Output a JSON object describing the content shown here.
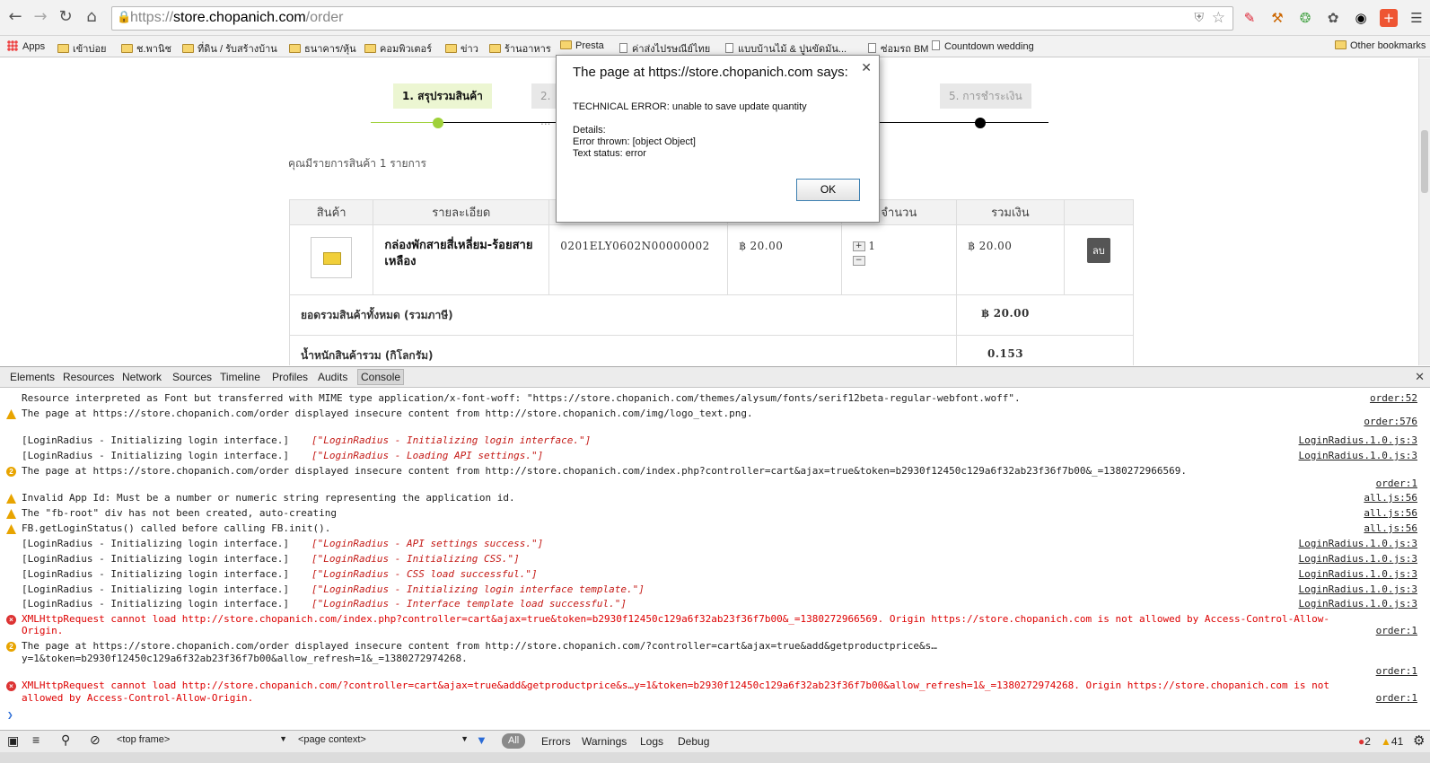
{
  "browser": {
    "url_proto": "https://",
    "url_host": "store.chopanich.com",
    "url_path": "/order",
    "bookmarks": [
      {
        "label": "Apps",
        "kind": "apps"
      },
      {
        "label": "เข้าบ่อย",
        "kind": "folder"
      },
      {
        "label": "ช.พานิช",
        "kind": "folder"
      },
      {
        "label": "ที่ดิน / รับสร้างบ้าน",
        "kind": "folder"
      },
      {
        "label": "ธนาคาร/หุ้น",
        "kind": "folder"
      },
      {
        "label": "คอมพิวเตอร์",
        "kind": "folder"
      },
      {
        "label": "ข่าว",
        "kind": "folder"
      },
      {
        "label": "ร้านอาหาร",
        "kind": "folder"
      },
      {
        "label": "Presta",
        "kind": "folder"
      },
      {
        "label": "ค่าส่งไปรษณีย์ไทย",
        "kind": "page"
      },
      {
        "label": "แบบบ้านไม้ & ปูนขัดมัน...",
        "kind": "page"
      },
      {
        "label": "ซ่อมรถ BM",
        "kind": "page"
      },
      {
        "label": "Countdown wedding",
        "kind": "page"
      }
    ],
    "other_bookmarks": "Other bookmarks"
  },
  "page": {
    "step1": "1. สรุปรวมสินค้า",
    "step2": "2. ...",
    "step5": "5. การชำระเงิน",
    "summary": "คุณมีรายการสินค้า 1 รายการ",
    "table_headers": [
      "สินค้า",
      "รายละเอียด",
      "",
      "",
      "จำนวน",
      "รวมเงิน",
      ""
    ],
    "product": {
      "name": "กล่องพักสายสี่เหลี่ยม-ร้อยสายเหลือง",
      "sku": "0201ELY0602N00000002",
      "unit_price": "฿ 20.00",
      "quantity": "1",
      "total": "฿ 20.00",
      "delete_label": "ลบ"
    },
    "total_label": "ยอดรวมสินค้าทั้งหมด (รวมภาษี)",
    "total_value": "฿ 20.00",
    "weight_label": "น้ำหนักสินค้ารวม (กิโลกรัม)",
    "weight_value": "0.153"
  },
  "dialog": {
    "title": "The page at https://store.chopanich.com says:",
    "message_line1": "TECHNICAL ERROR: unable to save update quantity",
    "details_label": "Details:",
    "details_line1": "Error thrown: [object Object]",
    "details_line2": "Text status: error",
    "ok_label": "OK"
  },
  "devtools": {
    "tabs": [
      "Elements",
      "Resources",
      "Network",
      "Sources",
      "Timeline",
      "Profiles",
      "Audits",
      "Console"
    ],
    "active_tab": "Console",
    "status": {
      "frame": "<top frame>",
      "context": "<page context>",
      "all": "All",
      "errors": "Errors",
      "warnings": "Warnings",
      "logs": "Logs",
      "debug": "Debug",
      "error_count": "2",
      "warning_count": "41"
    },
    "console": [
      {
        "icon": "",
        "text": "Resource interpreted as Font but transferred with MIME type application/x-font-woff: \"https://store.chopanich.com/themes/alysum/fonts/serif12beta-regular-webfont.woff\".",
        "src": "order:52"
      },
      {
        "icon": "warn",
        "text": "The page at https://store.chopanich.com/order displayed insecure content from http://store.chopanich.com/img/logo_text.png.",
        "src": ""
      },
      {
        "icon": "",
        "text": "",
        "src": "order:576"
      },
      {
        "icon": "",
        "text": "[LoginRadius - Initializing login interface.] ",
        "italic": "[\"LoginRadius - Initializing login interface.\"]",
        "src": "LoginRadius.1.0.js:3"
      },
      {
        "icon": "",
        "text": "[LoginRadius - Initializing login interface.] ",
        "italic": "[\"LoginRadius - Loading API settings.\"]",
        "src": "LoginRadius.1.0.js:3"
      },
      {
        "icon": "count",
        "count": "2",
        "text": "The page at https://store.chopanich.com/order displayed insecure content from http://store.chopanich.com/index.php?controller=cart&ajax=true&token=b2930f12450c129a6f32ab23f36f7b00&_=1380272966569.",
        "src": ""
      },
      {
        "icon": "",
        "text": "",
        "src": "order:1"
      },
      {
        "icon": "warn",
        "text": "Invalid App Id: Must be a number or numeric string representing the application id.",
        "src": "all.js:56"
      },
      {
        "icon": "warn",
        "text": "The \"fb-root\" div has not been created, auto-creating",
        "src": "all.js:56"
      },
      {
        "icon": "warn",
        "text": "FB.getLoginStatus() called before calling FB.init().",
        "src": "all.js:56"
      },
      {
        "icon": "",
        "text": "[LoginRadius - Initializing login interface.] ",
        "italic": "[\"LoginRadius - API settings success.\"]",
        "src": "LoginRadius.1.0.js:3"
      },
      {
        "icon": "",
        "text": "[LoginRadius - Initializing login interface.] ",
        "italic": "[\"LoginRadius - Initializing CSS.\"]",
        "src": "LoginRadius.1.0.js:3"
      },
      {
        "icon": "",
        "text": "[LoginRadius - Initializing login interface.] ",
        "italic": "[\"LoginRadius - CSS load successful.\"]",
        "src": "LoginRadius.1.0.js:3"
      },
      {
        "icon": "",
        "text": "[LoginRadius - Initializing login interface.] ",
        "italic": "[\"LoginRadius - Initializing login interface template.\"]",
        "src": "LoginRadius.1.0.js:3"
      },
      {
        "icon": "",
        "text": "[LoginRadius - Initializing login interface.] ",
        "italic": "[\"LoginRadius - Interface template load successful.\"]",
        "src": "LoginRadius.1.0.js:3"
      },
      {
        "icon": "err",
        "text": "XMLHttpRequest cannot load http://store.chopanich.com/index.php?controller=cart&ajax=true&token=b2930f12450c129a6f32ab23f36f7b00&_=1380272966569. Origin https://store.chopanich.com is not allowed by Access-Control-Allow-",
        "src": ""
      },
      {
        "icon": "",
        "text": "Origin.",
        "src": "order:1",
        "red": true
      },
      {
        "icon": "count",
        "count": "2",
        "text": "The page at https://store.chopanich.com/order displayed insecure content from http://store.chopanich.com/?controller=cart&ajax=true&add&getproductprice&s…",
        "src": ""
      },
      {
        "icon": "",
        "text": "y=1&token=b2930f12450c129a6f32ab23f36f7b00&allow_refresh=1&_=1380272974268.",
        "src": ""
      },
      {
        "icon": "",
        "text": "",
        "src": "order:1"
      },
      {
        "icon": "err",
        "text": "XMLHttpRequest cannot load http://store.chopanich.com/?controller=cart&ajax=true&add&getproductprice&s…y=1&token=b2930f12450c129a6f32ab23f36f7b00&allow_refresh=1&_=1380272974268. Origin https://store.chopanich.com is not",
        "src": ""
      },
      {
        "icon": "",
        "text": "allowed by Access-Control-Allow-Origin.",
        "src": "order:1",
        "red": true
      }
    ]
  },
  "colors": {
    "step_active_dot": "#9fd13a",
    "error_red": "#d00",
    "warning_orange": "#e8a400"
  }
}
